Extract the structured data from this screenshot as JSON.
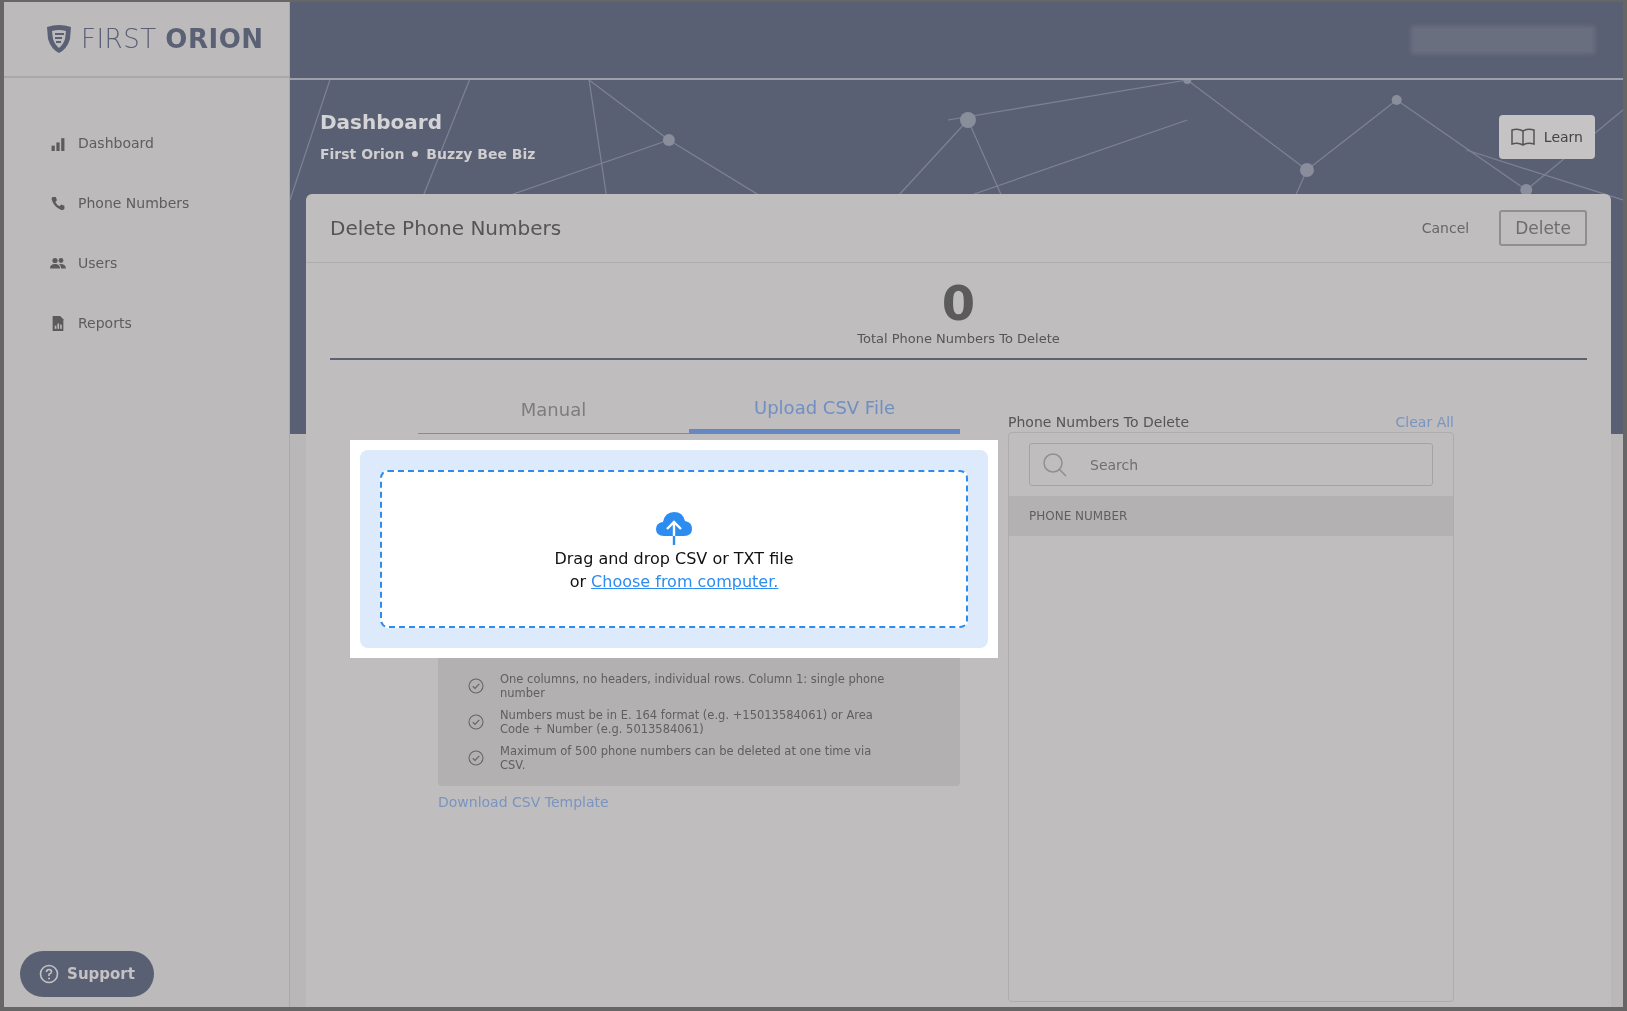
{
  "logo": {
    "light": "FIRST",
    "bold": "ORION"
  },
  "sidebar": {
    "items": [
      {
        "label": "Dashboard"
      },
      {
        "label": "Phone Numbers"
      },
      {
        "label": "Users"
      },
      {
        "label": "Reports"
      }
    ]
  },
  "support_button": {
    "label": "Support"
  },
  "header": {
    "title": "Dashboard",
    "breadcrumb": [
      "First Orion",
      "Buzzy Bee Biz"
    ],
    "learn_button": "Learn"
  },
  "modal": {
    "title": "Delete Phone Numbers",
    "cancel_button": "Cancel",
    "delete_button": {
      "label": "Delete",
      "disabled": true
    },
    "total": {
      "count": "0",
      "label": "Total Phone Numbers To Delete"
    },
    "tabs": [
      {
        "label": "Manual",
        "selected": false
      },
      {
        "label": "Upload CSV File",
        "selected": true
      }
    ],
    "dropzone": {
      "text": "Drag and drop CSV or TXT file",
      "prefix": "or",
      "link": "Choose from computer."
    },
    "rules": [
      "One columns, no headers, individual rows. Column 1: single phone number",
      "Numbers must be in E. 164 format (e.g. +15013584061) or Area Code + Number (e.g. 5013584061)",
      "Maximum of 500 phone numbers can be deleted at one time via CSV."
    ],
    "download_link": "Download CSV Template",
    "list": {
      "title": "Phone Numbers To Delete",
      "clear_all": "Clear All",
      "search": {
        "placeholder": "Search"
      },
      "columns": [
        "PHONE NUMBER"
      ]
    }
  }
}
